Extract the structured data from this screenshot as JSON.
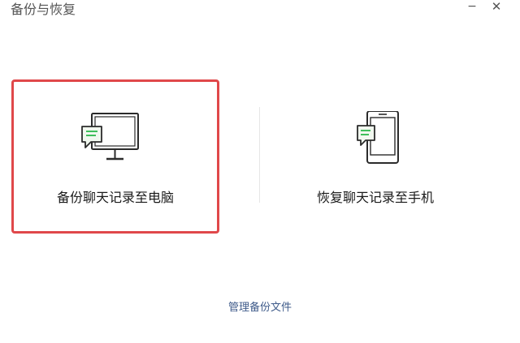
{
  "window": {
    "title": "备份与恢复",
    "minimize_glyph": "−",
    "close_glyph": "✕"
  },
  "options": {
    "backup_to_pc": {
      "label": "备份聊天记录至电脑",
      "icon": "computer-with-chat-icon",
      "selected": true
    },
    "restore_to_phone": {
      "label": "恢复聊天记录至手机",
      "icon": "phone-with-chat-icon",
      "selected": false
    }
  },
  "footer": {
    "manage_link": "管理备份文件"
  },
  "colors": {
    "selection_border": "#e0484a",
    "chat_bubble_fill": "#f1f8ef",
    "chat_lines": "#3fbf5b",
    "icon_stroke": "#2b2b2b",
    "link": "#3f5b8a",
    "divider": "#e6e6e6"
  }
}
